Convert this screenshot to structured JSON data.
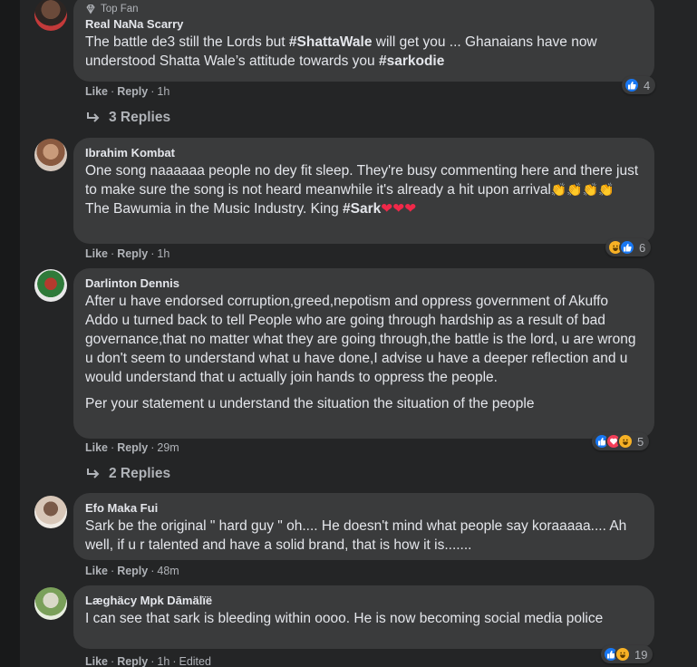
{
  "comments": [
    {
      "badge": "Top Fan",
      "author": "Real NaNa Scarry",
      "text_parts": [
        "The battle de3 still the Lords but ",
        "#ShattaWale",
        " will get you ... Ghanaians have now understood Shatta Wale’s attitude towards you ",
        "#sarkodie"
      ],
      "like": "Like",
      "reply": "Reply",
      "time": "1h",
      "reaction_count": "4",
      "reactions": [
        "like-icon"
      ],
      "replies_label": "3 Replies"
    },
    {
      "author": "Ibrahim Kombat",
      "line1": "One song naaaaaa people no dey fit sleep. They're busy commenting here and there just to make sure the song is not heard meanwhile it's already a hit upon arrival",
      "claps": "👏👏👏👏",
      "line2_prefix": "The Bawumia in the Music Industry. King ",
      "line2_hashtag": "#Sark",
      "hearts": "❤❤❤",
      "like": "Like",
      "reply": "Reply",
      "time": "1h",
      "reaction_count": "6",
      "reactions": [
        "haha-icon",
        "like-icon"
      ]
    },
    {
      "author": "Darlinton Dennis",
      "para1": "After u have endorsed corruption,greed,nepotism and oppress government of Akuffo Addo u turned back to tell People who are going through hardship as a result of bad governance,that no matter what they are going through,the battle is the lord, u are wrong u don't seem to understand what u have done,I advise u have a deeper reflection and u would understand that u actually join hands to oppress the people.",
      "para2": "Per your statement u understand the situation the situation of the people",
      "like": "Like",
      "reply": "Reply",
      "time": "29m",
      "reaction_count": "5",
      "reactions": [
        "like-icon",
        "love-icon",
        "haha-icon"
      ],
      "replies_label": "2 Replies"
    },
    {
      "author": "Efo Maka Fui",
      "text": "Sark be the original \" hard guy \" oh.... He doesn't mind what people say koraaaaa.... Ah well, if u r talented and have a solid brand, that is how it is.......",
      "like": "Like",
      "reply": "Reply",
      "time": "48m"
    },
    {
      "author": "Læghäcy Mpk Dāmälïë",
      "text": "I can see that sark is bleeding within oooo. He is now becoming social media police",
      "like": "Like",
      "reply": "Reply",
      "time": "1h",
      "edited": "Edited",
      "reaction_count": "19",
      "reactions": [
        "like-icon",
        "haha-icon"
      ]
    }
  ],
  "colors": {
    "page_bg": "#18191a",
    "panel_bg": "#242526",
    "bubble_bg": "#3a3b3c",
    "text_primary": "#e4e6eb",
    "text_secondary": "#b0b3b8",
    "like_blue": "#1877f2",
    "love_red": "#f33e58",
    "haha_yellow": "#f7b125"
  }
}
